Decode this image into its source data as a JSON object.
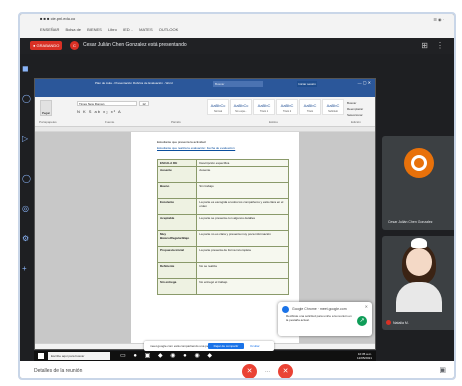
{
  "browser": {
    "tabs_text": "■  ■  ■  cie.pnl.edu.co",
    "bookmarks": [
      "ENSEÑAR",
      "Bolsa de",
      "BIENES",
      "Libro",
      "IED ..",
      "MATES",
      "OUTLOOK"
    ],
    "right_icons": "☰ ◉ ·"
  },
  "meet_banner": {
    "rec_label": "● GRABANDO",
    "presenter_initial": "C",
    "presenting_text": "Cesar Julián Chen Gonzalez está presentando"
  },
  "word": {
    "title": "Plan de Aula - Presentación Rubrica de Evaluación - Word",
    "search_placeholder": "Buscar",
    "signin_label": "Iniciar sesión",
    "tabs": [
      "Archivo",
      "Inicio",
      "Insertar",
      "Diseño",
      "Disposición",
      "Referencias",
      "Correspondencia",
      "Revisar",
      "Vista",
      "Ayuda",
      "Diseño",
      "Disposición",
      "¿Qué desea hacer?"
    ],
    "paste_label": "Pegar",
    "group_labels": [
      "Portapapeles",
      "Fuente",
      "Párrafo",
      "Estilos",
      "Edición"
    ],
    "font_name": "Times New Roman",
    "font_size": "12",
    "format_buttons": "N K S ab x₂ x² A",
    "styles": [
      {
        "sample": "AaBbCc",
        "caption": "Normal"
      },
      {
        "sample": "AaBbCc",
        "caption": "Sin espa..."
      },
      {
        "sample": "AaBbC",
        "caption": "Título 1"
      },
      {
        "sample": "AaBbC",
        "caption": "Título 2"
      },
      {
        "sample": "AaBbC",
        "caption": "Título"
      },
      {
        "sample": "AaBbC",
        "caption": "Subtítulo"
      }
    ],
    "edit_items": [
      "Buscar",
      "Reemplazar",
      "Seleccionar"
    ],
    "doc_lines": [
      "Estudiante que presenta la actividad:",
      "Estudiante que realiza la evaluación:   Fecha de evaluación:"
    ],
    "rubric_header": [
      "ESCALA DE",
      "Valoración"
    ],
    "rubric": [
      {
        "criterion": "ESCALA DE",
        "description": "Descripción específica"
      },
      {
        "criterion": "Ausente",
        "description": "Ausente"
      },
      {
        "criterion": "Bueno",
        "description": "Sin trabajo"
      },
      {
        "criterion": "Excelente",
        "description": "La parte es escogida a todos los compañeros y está clara en el orden"
      },
      {
        "criterion": "Aceptable",
        "description": "La parte se presenta con algunos detalles"
      },
      {
        "criterion": "Muy Básico/Regular/Bajo",
        "description": "La parte no es clara y presenta muy poca información"
      },
      {
        "criterion": "Propuesta inicial",
        "description": "La parte presenta de forma incompleta"
      },
      {
        "criterion": "Deficiente",
        "description": "No se realiza"
      },
      {
        "criterion": "Sin entrega",
        "description": "No entregó el trabajo"
      }
    ]
  },
  "notification": {
    "header": "Google Chrome · meet.google.com",
    "body": "Recibiste una solicitud para unirte a la reunión en la pestaña actual."
  },
  "share_bar": {
    "text": "meet.google.com está compartiendo una pestaña",
    "stop_label": "Dejar de compartir",
    "hide_label": "Ocultar"
  },
  "participants": {
    "presenter_name": "Cesar Julián Chen Gonzalez",
    "self_name": "Natalia M."
  },
  "taskbar": {
    "search_placeholder": "Escribe aquí para buscar",
    "apps": "▭ ● ▣ ◆ ◉ ● ◉ ◆",
    "time": "10:35 a.m.",
    "date": "12/05/2021"
  },
  "meet_bottom": {
    "meeting_label": "Detalles de la reunión",
    "hangup_dots": "···"
  },
  "colors": {
    "word_blue": "#2b579a",
    "meet_red": "#ea4335",
    "presenter_orange": "#e8710a",
    "rubric_green": "#eef2e2"
  }
}
